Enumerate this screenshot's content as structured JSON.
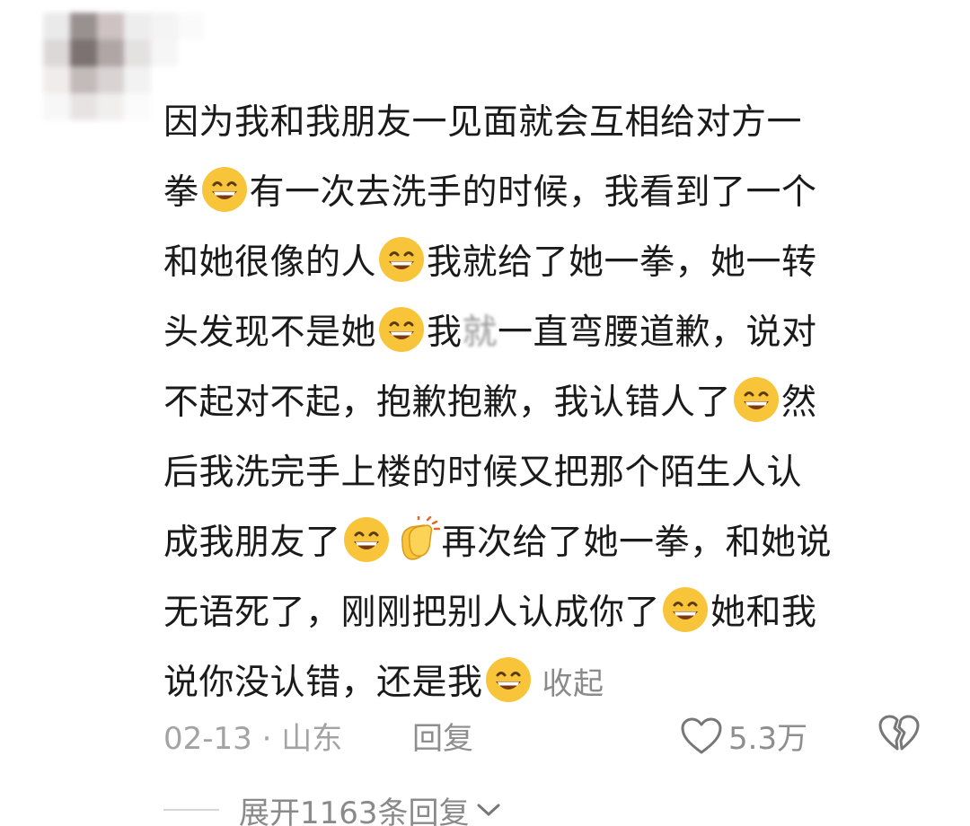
{
  "comment": {
    "avatar_icon": "blurred-avatar-icon",
    "lines": [
      [
        "因为我和我朋友一见面就会互相给对方一"
      ],
      [
        "拳",
        "EMOJI",
        "有一次去洗手的时候，我看到了一个"
      ],
      [
        "和她很像的人",
        "EMOJI",
        "我就给了她一拳，她一转"
      ],
      [
        "头发现不是她",
        "EMOJI",
        "我",
        "BLUR",
        "一直弯腰道歉，说对"
      ],
      [
        "不起对不起，抱歉抱歉，我认错人了",
        "EMOJI",
        "然"
      ],
      [
        "后我洗完手上楼的时候又把那个陌生人认"
      ],
      [
        "成我朋友了",
        "EMOJI",
        "CLAP",
        "再次给了她一拳，和她说"
      ],
      [
        "无语死了，刚刚把别人认成你了",
        "EMOJI",
        "她和我"
      ],
      [
        "说你没认错，还是我",
        "EMOJI"
      ]
    ],
    "l0": "因为我和我朋友一见面就会互相给对方一",
    "l1a": "拳",
    "l1b": "有一次去洗手的时候，我看到了一个",
    "l2a": "和她很像的人",
    "l2b": "我就给了她一拳，她一转",
    "l3a": "头发现不是她",
    "l3b": "我",
    "l3blur": "就",
    "l3c": "一直弯腰道歉，说对",
    "l4a": "不起对不起，抱歉抱歉，我认错人了",
    "l4b": "然",
    "l5": "后我洗完手上楼的时候又把那个陌生人认",
    "l6a": "成我朋友了",
    "l6b": "再次给了她一拳，和她说",
    "l7a": "无语死了，刚刚把别人认成你了",
    "l7b": "她和我",
    "l8a": "说你没认错，还是我",
    "collapse_label": "收起",
    "emoji_icon": "grinning-face-icon",
    "clap_icon": "clapping-hands-icon"
  },
  "meta": {
    "date_location": "02-13 · 山东",
    "reply_label": "回复",
    "like_icon": "heart-icon",
    "like_count": "5.3万",
    "dislike_icon": "broken-heart-icon"
  },
  "expand": {
    "label": "展开1163条回复",
    "icon": "chevron-down-icon"
  },
  "colors": {
    "text": "#1a1a1a",
    "secondary": "#8a8a8a",
    "emoji_face": "#f7c43a"
  }
}
